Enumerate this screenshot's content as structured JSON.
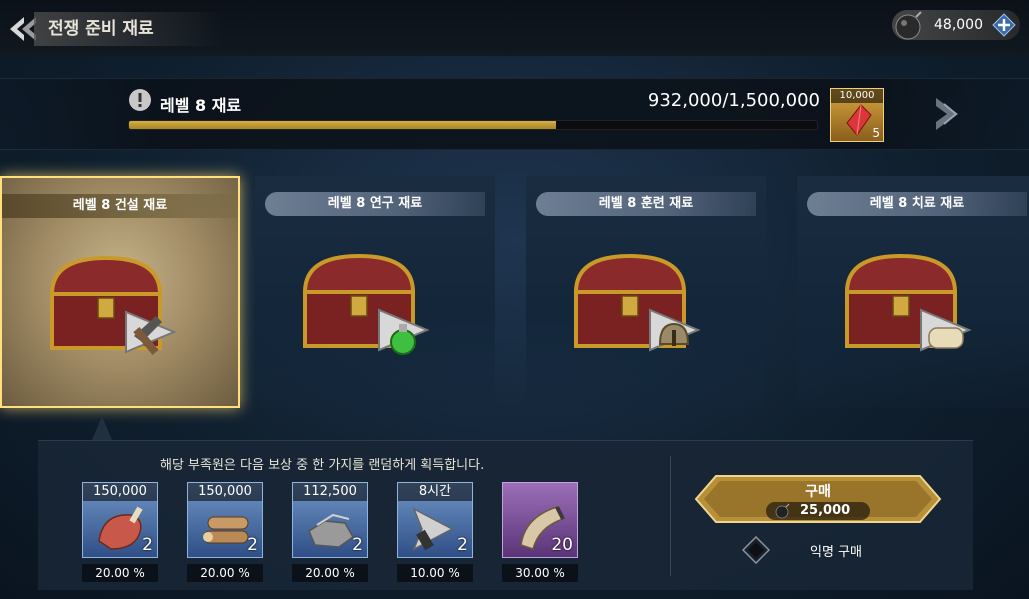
{
  "header": {
    "title": "전쟁 준비 재료"
  },
  "currency": {
    "amount": "48,000",
    "icon": "bomb-icon"
  },
  "level": {
    "title": "레벨 8 재료",
    "progress_text": "932,000/1,500,000",
    "progress": 0.621,
    "reward": {
      "top_value": "10,000",
      "qty": "5",
      "icon": "red-gem-icon"
    }
  },
  "cards": [
    {
      "label": "레벨 8 건설 재료",
      "selected": true,
      "icon": "hammer-icon"
    },
    {
      "label": "레벨 8 연구 재료",
      "selected": false,
      "icon": "potion-icon"
    },
    {
      "label": "레벨 8 훈련 재료",
      "selected": false,
      "icon": "helmet-icon"
    },
    {
      "label": "레벨 8 치료 재료",
      "selected": false,
      "icon": "scroll-icon"
    }
  ],
  "rewards_panel": {
    "description": "해당 부족원은 다음 보상 중 한 가지를 랜덤하게 획득합니다.",
    "items": [
      {
        "amount": "150,000",
        "qty": "2",
        "percent": "20.00 %",
        "icon": "meat-icon"
      },
      {
        "amount": "150,000",
        "qty": "2",
        "percent": "20.00 %",
        "icon": "wood-icon"
      },
      {
        "amount": "112,500",
        "qty": "2",
        "percent": "20.00 %",
        "icon": "stone-icon"
      },
      {
        "amount": "8시간",
        "qty": "2",
        "percent": "10.00 %",
        "icon": "speedup-icon"
      },
      {
        "amount": "",
        "qty": "20",
        "percent": "30.00 %",
        "icon": "horn-icon"
      }
    ]
  },
  "purchase": {
    "label": "구매",
    "price": "25,000",
    "anonymous_label": "익명 구매"
  },
  "colors": {
    "accent_gold": "#d8b04a",
    "rare_blue": "#2f4f86",
    "epic_purple": "#5a3478"
  }
}
